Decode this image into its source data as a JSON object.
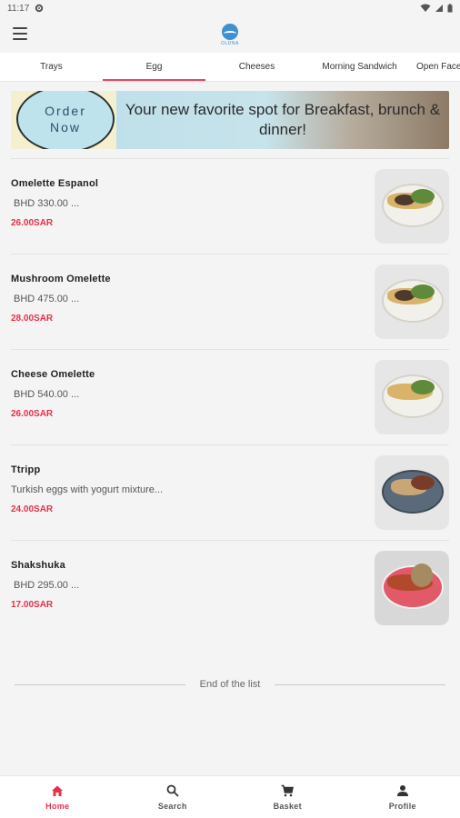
{
  "status_bar": {
    "time": "11:17"
  },
  "header": {
    "logo_text": "OLDNA"
  },
  "tabs": [
    {
      "label": "Trays"
    },
    {
      "label": "Egg"
    },
    {
      "label": "Cheeses"
    },
    {
      "label": "Morning Sandwich"
    },
    {
      "label": "Open Face"
    }
  ],
  "banner": {
    "order_line1": "Order",
    "order_line2": "Now",
    "tagline": "Your new favorite spot for Breakfast, brunch & dinner!"
  },
  "items": [
    {
      "name": "Omelette Espanol",
      "desc": "BHD  330.00 ...",
      "price": "26.00SAR"
    },
    {
      "name": "Mushroom Omelette",
      "desc": "BHD  475.00 ...",
      "price": "28.00SAR"
    },
    {
      "name": "Cheese Omelette",
      "desc": "BHD  540.00 ...",
      "price": "26.00SAR"
    },
    {
      "name": "Ttripp",
      "desc": "Turkish eggs with yogurt mixture...",
      "price": "24.00SAR"
    },
    {
      "name": "Shakshuka",
      "desc": "BHD  295.00 ...",
      "price": "17.00SAR"
    }
  ],
  "end_of_list": "End of the list",
  "bottom_nav": {
    "home": "Home",
    "search": "Search",
    "basket": "Basket",
    "profile": "Profile"
  },
  "colors": {
    "accent": "#e8304a",
    "logo": "#3f8fd3"
  }
}
